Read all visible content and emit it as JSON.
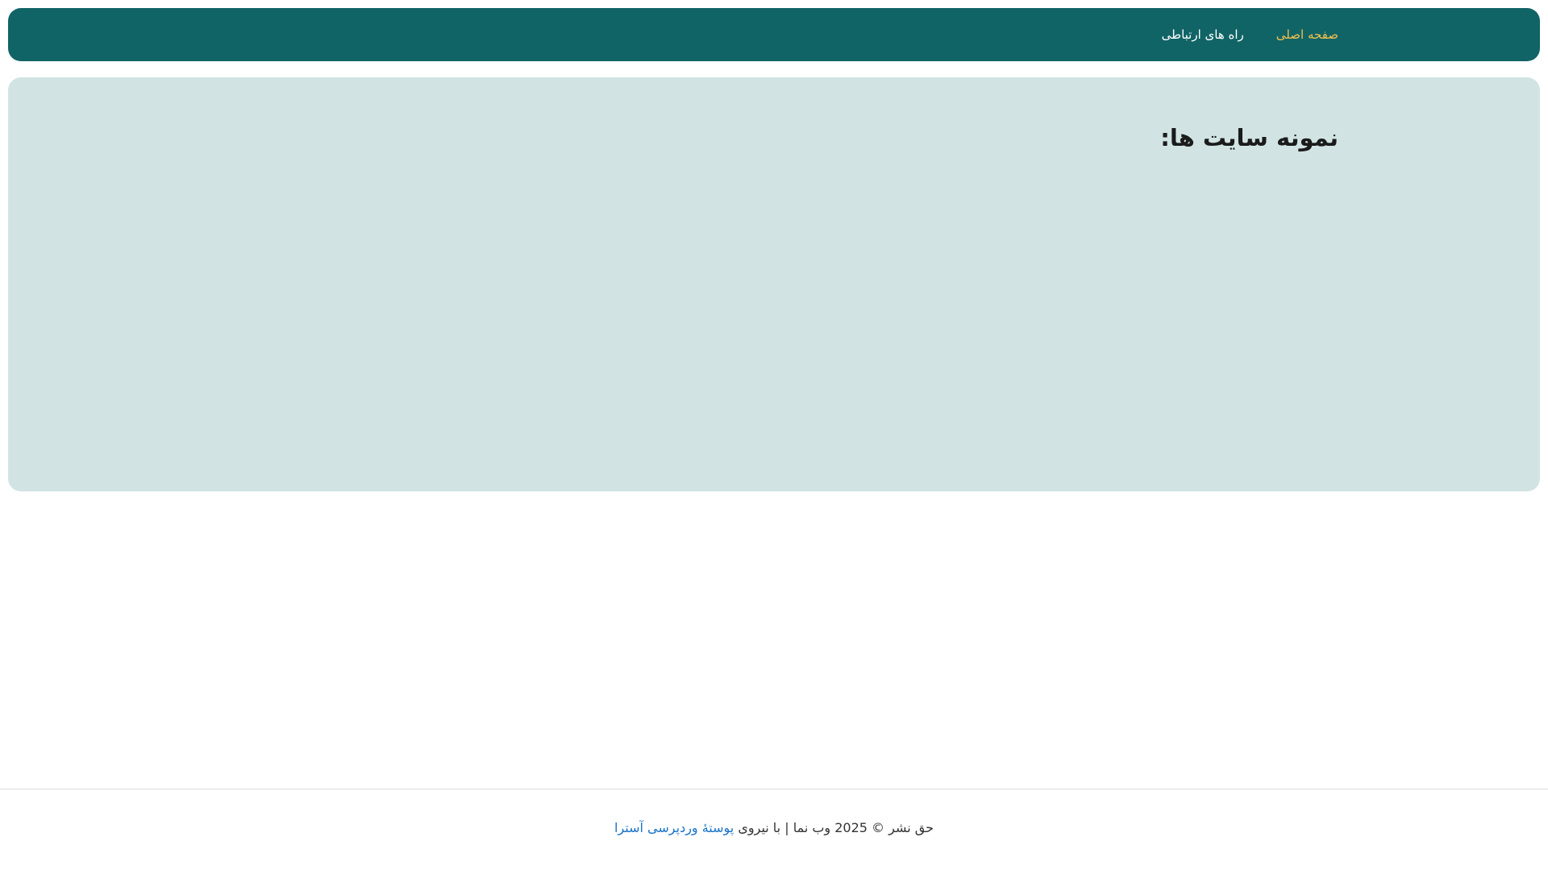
{
  "header": {
    "background_color": "#116466",
    "nav": [
      {
        "label": "صفحه اصلی",
        "active": true,
        "color": "#f2c14e"
      },
      {
        "label": "راه های ارتباطی",
        "active": false,
        "color": "#ffffff"
      }
    ]
  },
  "main": {
    "background_color": "#d1e4e3",
    "title": "نمونه سایت ها:"
  },
  "footer": {
    "copyright": "حق نشر © 2025 وب نما | با نیروی",
    "theme_link": "پوستهٔ وردپرسی آسترا",
    "link_color": "#1a73c8"
  }
}
